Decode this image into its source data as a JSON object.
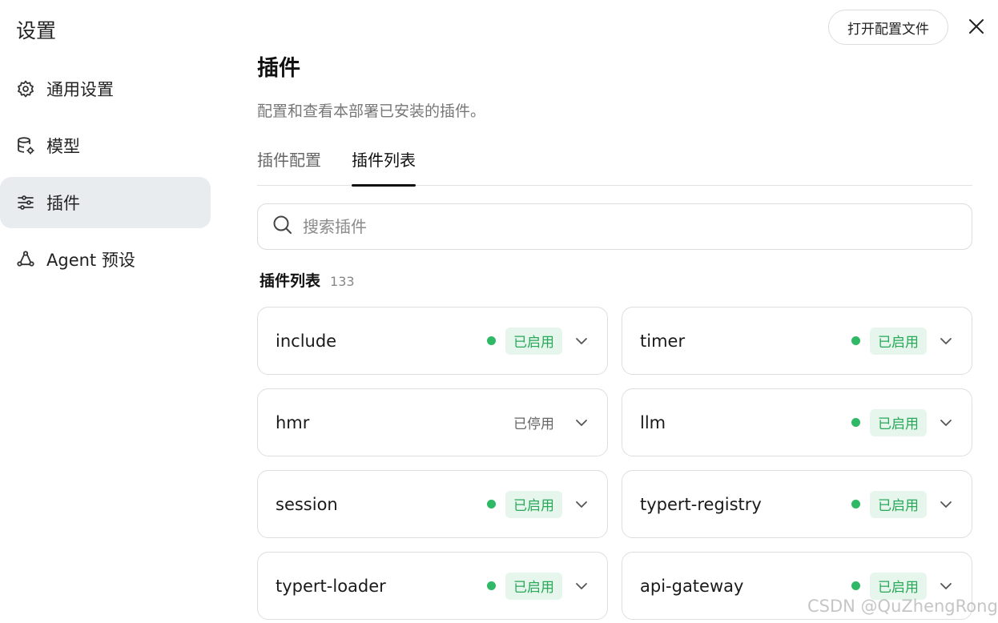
{
  "app": {
    "title": "设置",
    "open_config_label": "打开配置文件"
  },
  "sidebar": {
    "items": [
      {
        "label": "通用设置",
        "icon": "gear-icon",
        "active": false
      },
      {
        "label": "模型",
        "icon": "database-gear-icon",
        "active": false
      },
      {
        "label": "插件",
        "icon": "sliders-icon",
        "active": true
      },
      {
        "label": "Agent 预设",
        "icon": "agent-icon",
        "active": false
      }
    ]
  },
  "main": {
    "title": "插件",
    "description": "配置和查看本部署已安装的插件。",
    "tabs": [
      {
        "label": "插件配置",
        "active": false
      },
      {
        "label": "插件列表",
        "active": true
      }
    ],
    "search": {
      "placeholder": "搜索插件",
      "value": ""
    },
    "list_title": "插件列表",
    "list_count": "133",
    "plugins": [
      {
        "name": "include",
        "status": "已启用",
        "enabled": true
      },
      {
        "name": "timer",
        "status": "已启用",
        "enabled": true
      },
      {
        "name": "hmr",
        "status": "已停用",
        "enabled": false
      },
      {
        "name": "llm",
        "status": "已启用",
        "enabled": true
      },
      {
        "name": "session",
        "status": "已启用",
        "enabled": true
      },
      {
        "name": "typert-registry",
        "status": "已启用",
        "enabled": true
      },
      {
        "name": "typert-loader",
        "status": "已启用",
        "enabled": true
      },
      {
        "name": "api-gateway",
        "status": "已启用",
        "enabled": true
      }
    ]
  },
  "colors": {
    "enabled_green": "#2fb866",
    "enabled_bg": "#e6f6ec",
    "active_nav_bg": "#e9ecef"
  },
  "watermark": "CSDN @QuZhengRong"
}
